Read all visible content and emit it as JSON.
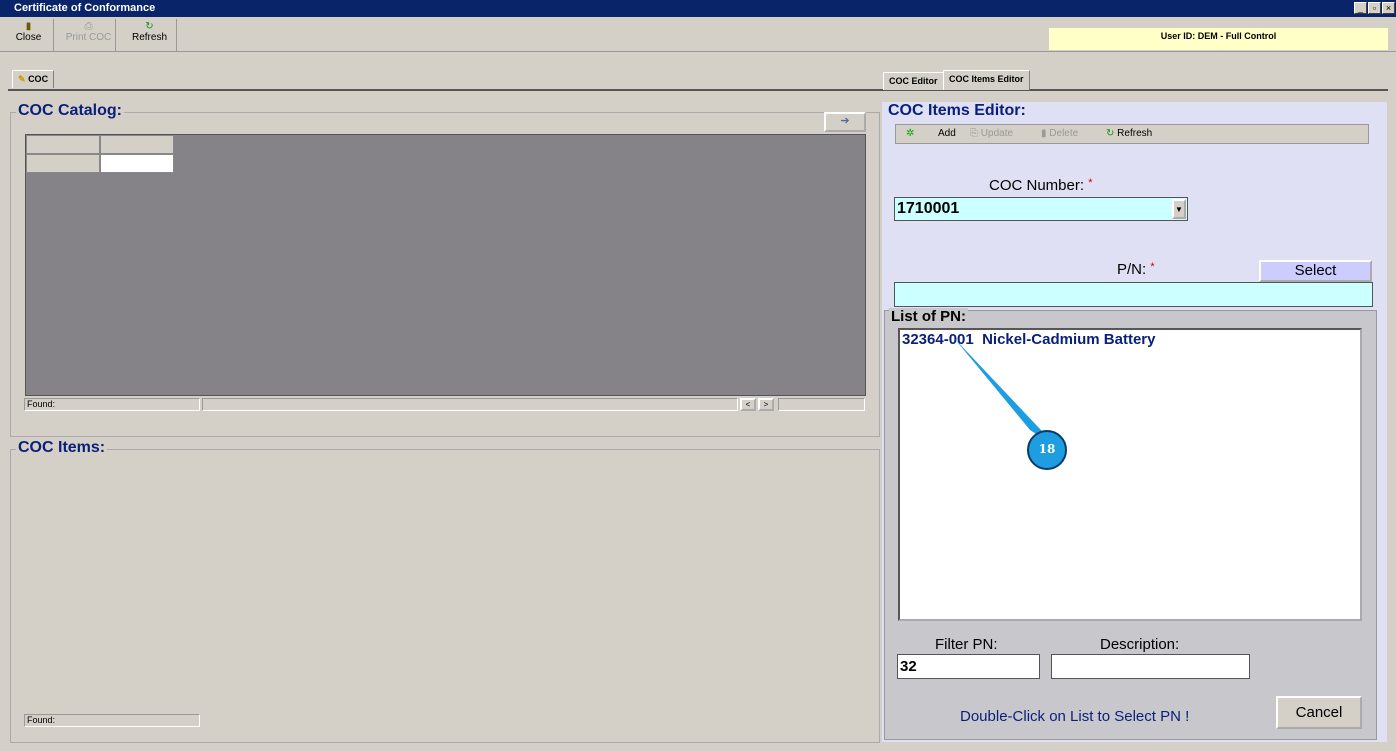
{
  "window": {
    "title": "Certificate of Conformance"
  },
  "toolbar": {
    "close": "Close",
    "print": "Print COC",
    "refresh": "Refresh"
  },
  "user_info": "User ID: DEM - Full Control",
  "left_tab": "COC",
  "right_tabs": [
    "COC Editor",
    "COC Items Editor"
  ],
  "catalog": {
    "title": "COC Catalog:",
    "found": "Found:"
  },
  "items": {
    "title": "COC Items:",
    "found": "Found:"
  },
  "editor": {
    "title": "COC Items Editor:",
    "add": "Add",
    "update": "Update",
    "delete": "Delete",
    "refresh": "Refresh",
    "coc_number_label": "COC Number:",
    "coc_number": "1710001",
    "pn_label": "P/N:",
    "required": "*",
    "select": "Select"
  },
  "pn_list": {
    "title": "List of PN:",
    "items": [
      {
        "pn": "32364-001",
        "description": "Nickel-Cadmium Battery"
      }
    ],
    "filter_label": "Filter PN:",
    "filter_value": "32",
    "desc_label": "Description:",
    "desc_value": "",
    "hint": "Double-Click on List to Select PN !",
    "cancel": "Cancel"
  },
  "annotation": {
    "number": "18"
  }
}
